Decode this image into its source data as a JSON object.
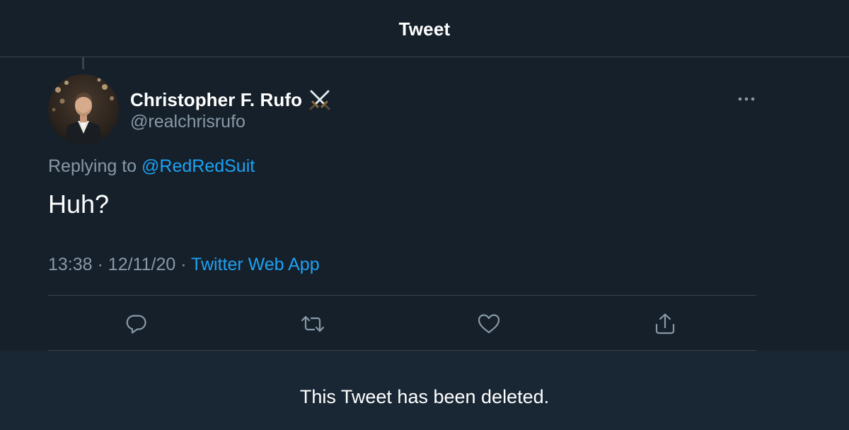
{
  "header": {
    "title": "Tweet"
  },
  "tweet": {
    "display_name": "Christopher F. Rufo",
    "name_emoji_icon": "crossed-swords-icon",
    "handle": "@realchrisrufo",
    "replying_prefix": "Replying to",
    "replying_to": "@RedRedSuit",
    "text": "Huh?",
    "time": "13:38",
    "separator": "·",
    "date": "12/11/20",
    "source": "Twitter Web App"
  },
  "actions": [
    {
      "name": "reply",
      "icon": "reply-icon"
    },
    {
      "name": "retweet",
      "icon": "retweet-icon"
    },
    {
      "name": "like",
      "icon": "heart-icon"
    },
    {
      "name": "share",
      "icon": "share-icon"
    }
  ],
  "notice": {
    "deleted_text": "This Tweet has been deleted."
  },
  "colors": {
    "background": "#15202b",
    "banner": "#192734",
    "divider": "#38444d",
    "secondary_text": "#8899a6",
    "link": "#1da1f2",
    "primary_text": "#ffffff"
  }
}
